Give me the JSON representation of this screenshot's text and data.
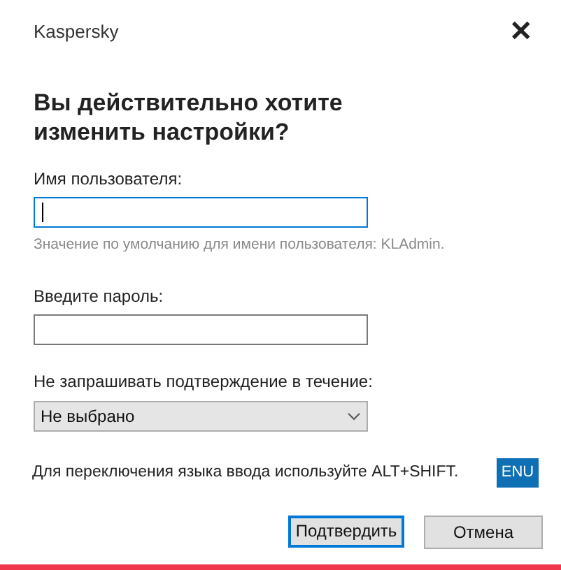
{
  "window": {
    "title": "Kaspersky",
    "close": "✕"
  },
  "heading": "Вы действительно хотите изменить настройки?",
  "fields": [
    {
      "label": "Имя пользователя:",
      "focused": true,
      "hint": "Значение по умолчанию для имени пользователя: KLAdmin."
    },
    {
      "label": "Введите пароль:",
      "focused": false
    }
  ],
  "select": {
    "label": "Не запрашивать подтверждение в течение:",
    "value": "Не выбрано"
  },
  "language": {
    "text": "Для переключения языка ввода используйте ALT+SHIFT.",
    "badge": "ENU"
  },
  "buttons": [
    {
      "label": "Подтвердить",
      "default": true
    },
    {
      "label": "Отмена",
      "default": false
    }
  ]
}
